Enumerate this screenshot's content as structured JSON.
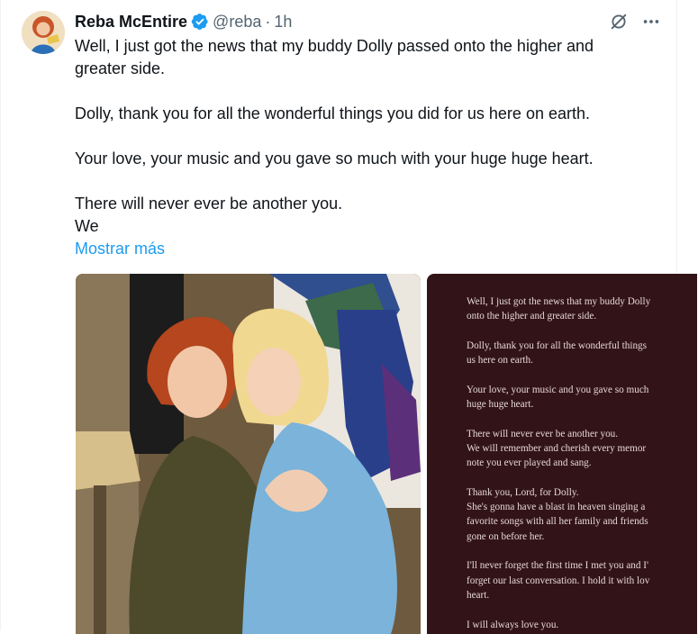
{
  "tweet": {
    "author_name": "Reba McEntire",
    "handle": "@reba",
    "separator": "·",
    "time": "1h",
    "paragraphs": [
      [
        "Well, I just got the news that my buddy Dolly passed onto the higher and",
        "greater side."
      ],
      [
        "Dolly, thank you for all the wonderful things you did for us here on earth."
      ],
      [
        "Your love, your music and you gave so much with your huge huge heart."
      ],
      [
        "There will never ever be another you.",
        "We"
      ]
    ],
    "show_more": "Mostrar más"
  },
  "statement_image": {
    "lines": [
      [
        "Well, I just got the news that my buddy Dolly",
        "onto the higher and greater side."
      ],
      [
        "Dolly, thank you for all the wonderful things",
        "us here on earth."
      ],
      [
        "Your love, your music and you gave so much",
        "huge huge heart."
      ],
      [
        "There will never ever be another you.",
        "We will remember and cherish every memor",
        "note you ever played and sang."
      ],
      [
        "Thank you, Lord, for Dolly.",
        "She's gonna have a blast in heaven singing a",
        "favorite songs with all her family and friends",
        "gone on before her."
      ],
      [
        "I'll never forget the first time I met you and I'",
        "forget our last conversation. I hold it with lov",
        "heart."
      ],
      [
        "I will always love you."
      ]
    ]
  },
  "icons": {
    "verified": "verified-badge-icon",
    "grok": "grok-icon",
    "more": "more-icon"
  },
  "colors": {
    "verified": "#1d9bf0",
    "link": "#1d9bf0",
    "secondary_text": "#536471",
    "statement_bg": "#321418"
  }
}
